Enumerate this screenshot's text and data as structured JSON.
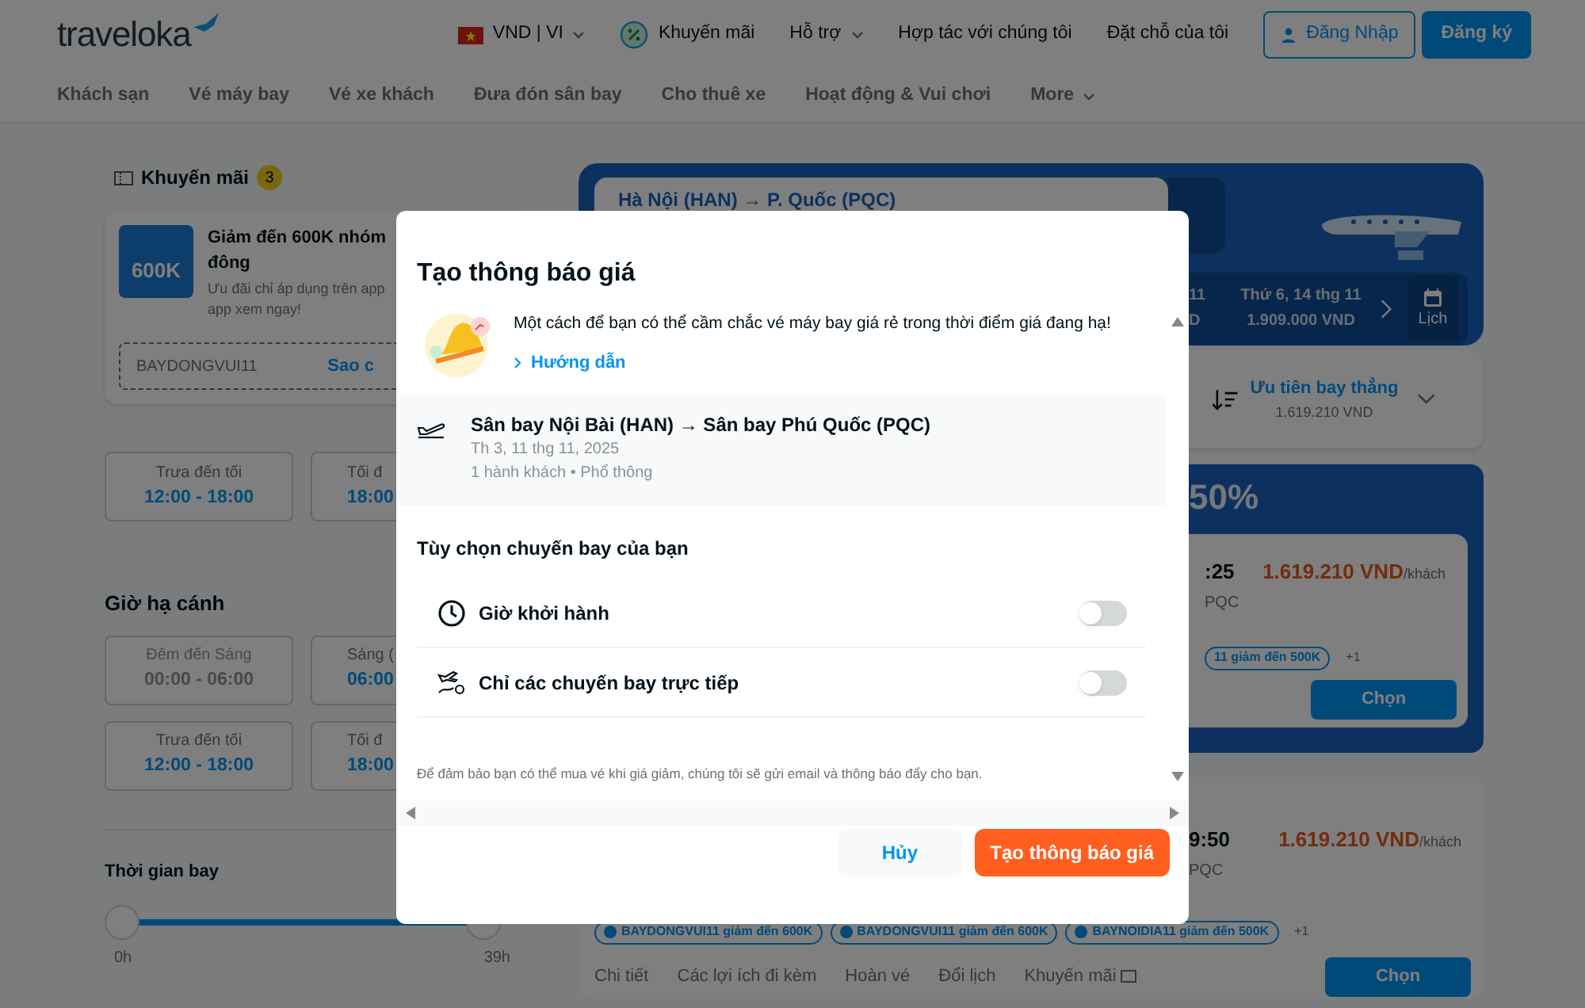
{
  "header": {
    "logo": "traveloka",
    "nav": [
      {
        "kind": "currency",
        "label": "VND | VI"
      },
      {
        "kind": "promo",
        "label": "Khuyến mãi"
      },
      {
        "kind": "dropdown",
        "label": "Hỗ trợ"
      },
      {
        "kind": "link",
        "label": "Hợp tác với chúng tôi"
      },
      {
        "kind": "link",
        "label": "Đặt chỗ của tôi"
      }
    ],
    "login": "Đăng Nhập",
    "register": "Đăng ký"
  },
  "categories": [
    {
      "label": "Khách sạn",
      "dropdown": false
    },
    {
      "label": "Vé máy bay",
      "dropdown": false
    },
    {
      "label": "Vé xe khách",
      "dropdown": false
    },
    {
      "label": "Đưa đón sân bay",
      "dropdown": false
    },
    {
      "label": "Cho thuê xe",
      "dropdown": false
    },
    {
      "label": "Hoạt động & Vui chơi",
      "dropdown": false
    },
    {
      "label": "More",
      "dropdown": true
    }
  ],
  "sidebar": {
    "promo_title": "Khuyến mãi",
    "promo_count": "3",
    "promo_card": {
      "image_text": "600K",
      "title": "Giảm đến 600K nhóm đông",
      "description_lines": [
        "Ưu đãi chỉ áp dụng trên app",
        "app xem ngay!"
      ],
      "code": "BAYDONGVUI11",
      "copy": "Sao c"
    },
    "departure_slots": [
      {
        "label": "Trưa đến tối",
        "time": "12:00 - 18:00",
        "disabled": false
      },
      {
        "label": "Tối đ",
        "time": "18:00",
        "disabled": false
      }
    ],
    "arrival_title": "Giờ hạ cánh",
    "arrival_slots": [
      {
        "label": "Đêm đến Sáng",
        "time": "00:00 - 06:00",
        "disabled": true
      },
      {
        "label": "Sáng (",
        "time": "06:00",
        "disabled": false
      },
      {
        "label": "Trưa đến tối",
        "time": "12:00 - 18:00",
        "disabled": false
      },
      {
        "label": "Tối đ",
        "time": "18:00",
        "disabled": false
      }
    ],
    "duration": {
      "title": "Thời gian bay",
      "level": 1,
      "min": "0h",
      "max": "39h"
    }
  },
  "results": {
    "route": "Hà Nội (HAN) → P. Quốc (PQC)",
    "dates": [
      {
        "day": "11",
        "price": "D"
      },
      {
        "day": "Thứ 6, 14 thg 11",
        "price": "1.909.000 VND"
      }
    ],
    "calendar": "Lịch",
    "sort": {
      "label": "Ưu tiên bay thẳng",
      "price": "1.619.210 VND"
    },
    "banner": "50%",
    "flights": [
      {
        "time": ":25",
        "airport": "PQC",
        "price": "1.619.210 VND",
        "unit": "/khách",
        "tags": [
          "11 giảm đến 500K"
        ],
        "more": "+1",
        "button": "Chọn"
      },
      {
        "time": "9:50",
        "airport": "PQC",
        "price": "1.619.210 VND",
        "unit": "/khách",
        "tags": [
          "BAYDONGVUI11 giảm đến 600K",
          "BAYDONGVUI11 giảm đến 600K",
          "BAYNOIDIA11 giảm đến 500K"
        ],
        "more": "+1",
        "button": "Chọn",
        "tabs": [
          "Chi tiết",
          "Các lợi ích đi kèm",
          "Hoàn vé",
          "Đổi lịch",
          "Khuyến mãi"
        ]
      }
    ]
  },
  "dialog": {
    "title": "Tạo thông báo giá",
    "intro": "Một cách để bạn có thể cầm chắc vé máy bay giá rẻ trong thời điểm giá đang hạ!",
    "guide": "Hướng dẫn",
    "trip": {
      "route": "Sân bay Nội Bài (HAN) → Sân bay Phú Quốc (PQC)",
      "date": "Th 3, 11 thg 11, 2025",
      "passengers": "1 hành khách • Phổ thông"
    },
    "options_title": "Tùy chọn chuyến bay của bạn",
    "options": [
      {
        "kind": "time",
        "label": "Giờ khởi hành",
        "on": false
      },
      {
        "kind": "direct",
        "label": "Chỉ các chuyến bay trực tiếp",
        "on": false
      }
    ],
    "note": "Để đảm bảo bạn có thể mua vé khi giá giảm, chúng tôi sẽ gửi email và thông báo đẩy cho bạn.",
    "cancel": "Hủy",
    "submit": "Tạo thông báo giá"
  }
}
